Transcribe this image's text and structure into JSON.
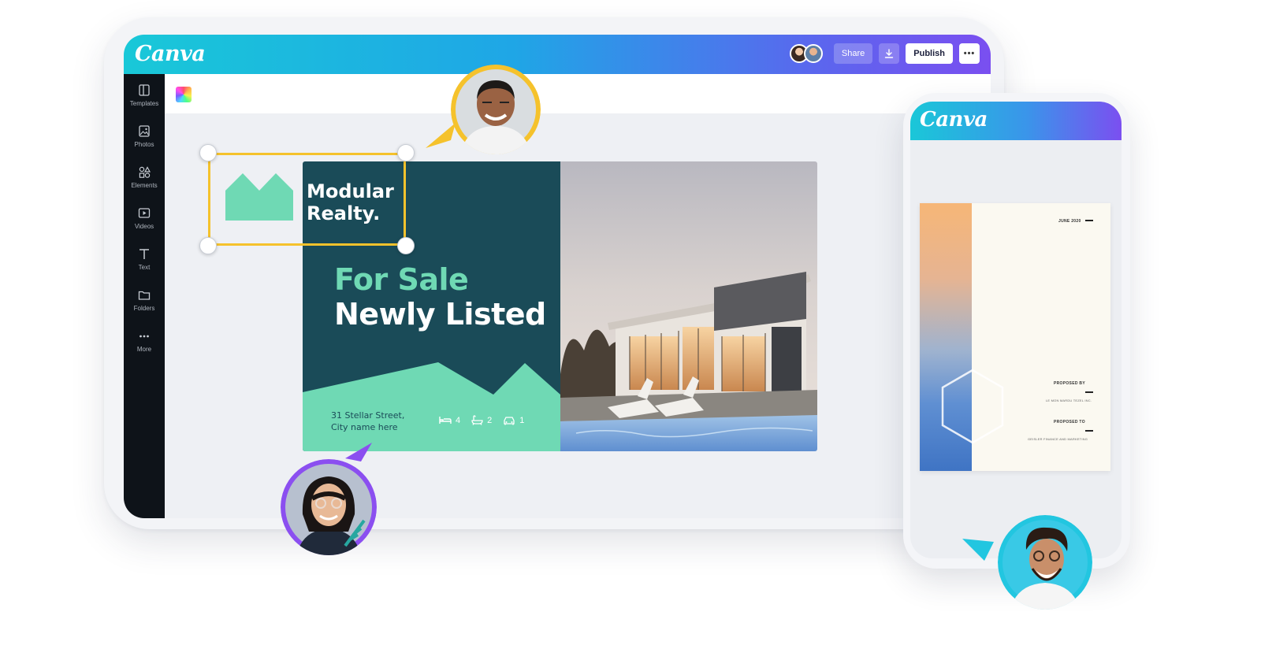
{
  "app": {
    "logo_text": "Canva",
    "topbar": {
      "share_label": "Share",
      "download_icon": "download-icon",
      "publish_label": "Publish",
      "more_label": "•••"
    },
    "sidebar": {
      "items": [
        {
          "label": "Templates",
          "icon": "templates-icon"
        },
        {
          "label": "Photos",
          "icon": "photos-icon"
        },
        {
          "label": "Elements",
          "icon": "elements-icon"
        },
        {
          "label": "Videos",
          "icon": "videos-icon"
        },
        {
          "label": "Text",
          "icon": "text-icon"
        },
        {
          "label": "Folders",
          "icon": "folder-icon"
        },
        {
          "label": "More",
          "icon": "more-icon"
        }
      ]
    }
  },
  "design": {
    "brand_line1": "Modular",
    "brand_line2": "Realty.",
    "headline_line1": "For Sale",
    "headline_line2": "Newly Listed",
    "address_line1": "31 Stellar Street,",
    "address_line2": "City name here",
    "amenities": [
      {
        "icon": "bed-icon",
        "count": "4"
      },
      {
        "icon": "bathtub-icon",
        "count": "2"
      },
      {
        "icon": "car-icon",
        "count": "1"
      }
    ]
  },
  "phone": {
    "logo_text": "Canva",
    "doc": {
      "date": "JUNE 2020",
      "proposed_by_label": "PROPOSED BY",
      "proposed_by_value": "LE MON MARDU TEZEL INC.",
      "proposed_to_label": "PROPOSED TO",
      "proposed_to_value": "GEISLER FINANCE AND MARKETING"
    }
  },
  "colors": {
    "brand_gradient_start": "#19c8d8",
    "brand_gradient_end": "#7a4ff0",
    "design_teal": "#1a4b58",
    "design_mint": "#6fd9b4",
    "selection": "#f5c22c",
    "collaborator_yellow": "#f5c22c",
    "collaborator_purple": "#8b4ff0",
    "collaborator_cyan": "#22c6e0"
  }
}
